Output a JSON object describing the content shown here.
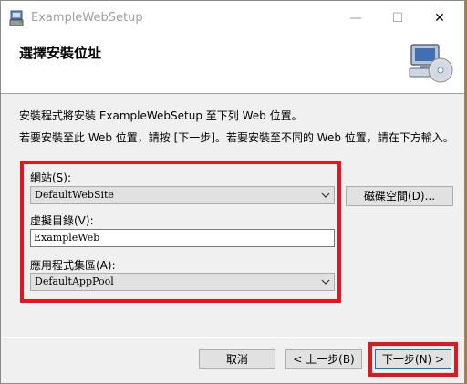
{
  "window": {
    "title": "ExampleWebSetup",
    "minimize_glyph": "—",
    "maximize_glyph": "☐",
    "close_glyph": "✕"
  },
  "banner": {
    "title": "選擇安裝位址",
    "icon": "computer-cd-icon"
  },
  "description": {
    "line1": "安裝程式將安裝 ExampleWebSetup 至下列 Web 位置。",
    "line2": "若要安裝至此 Web 位置，請按 [下一步]。若要安裝至不同的 Web 位置，請在下方輸入。"
  },
  "form": {
    "site_label": "網站(S):",
    "site_value": "DefaultWebSite",
    "dir_label": "虛擬目錄(V):",
    "dir_value": "ExampleWeb",
    "pool_label": "應用程式集區(A):",
    "pool_value": "DefaultAppPool"
  },
  "buttons": {
    "disk_space": "磁碟空間(D)...",
    "cancel": "取消",
    "back": "< 上一步(B)",
    "next": "下一步(N) >"
  },
  "colors": {
    "highlight": "#e8141c",
    "focus": "#0078d7"
  }
}
